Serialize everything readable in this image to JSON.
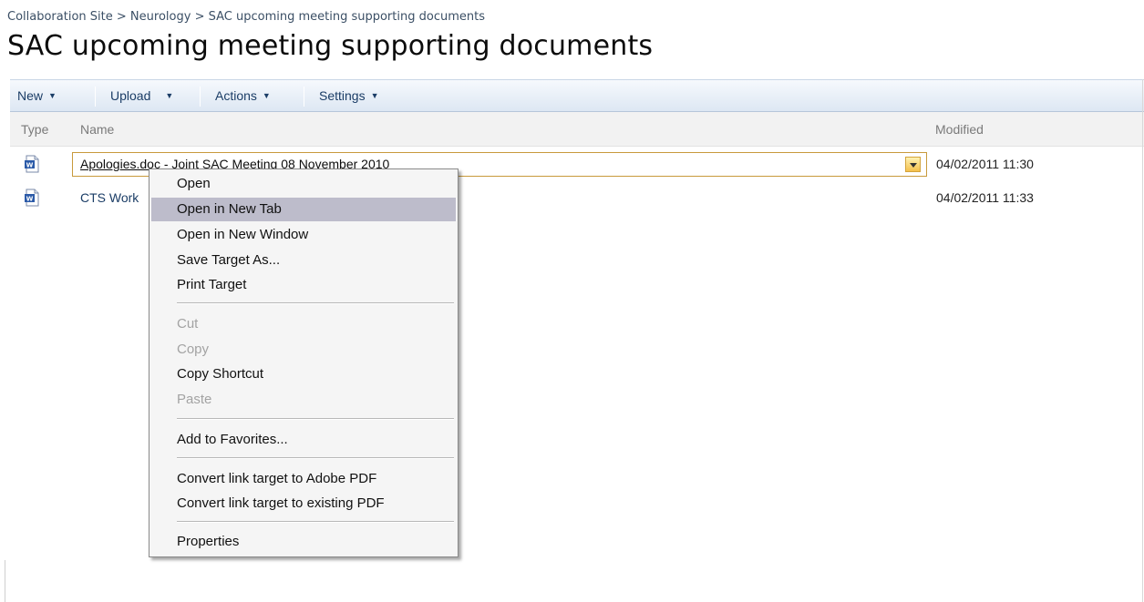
{
  "breadcrumb": {
    "items": [
      "Collaboration Site",
      "Neurology",
      "SAC upcoming meeting supporting documents"
    ],
    "separator": ">"
  },
  "page": {
    "title": "SAC upcoming meeting supporting documents"
  },
  "toolbar": {
    "new_label": "New",
    "upload_label": "Upload",
    "actions_label": "Actions",
    "settings_label": "Settings"
  },
  "list": {
    "headers": {
      "type": "Type",
      "name": "Name",
      "modified": "Modified"
    },
    "rows": [
      {
        "type_icon": "word-doc-icon",
        "name": "Apologies.doc - Joint SAC Meeting 08 November 2010",
        "modified": "04/02/2011 11:30"
      },
      {
        "type_icon": "word-doc-icon",
        "name": "CTS Work",
        "modified": "04/02/2011 11:33"
      }
    ]
  },
  "context_menu": {
    "items": [
      "Open",
      "Open in New Tab",
      "Open in New Window",
      "Save Target As...",
      "Print Target",
      "Cut",
      "Copy",
      "Copy Shortcut",
      "Paste",
      "Add to Favorites...",
      "Convert link target to Adobe PDF",
      "Convert link target to existing PDF",
      "Properties"
    ],
    "highlighted": "Open in New Tab",
    "disabled": [
      "Cut",
      "Copy",
      "Paste"
    ]
  },
  "colors": {
    "toolbar_text": "#1b3d66",
    "menu_highlight": "#bdbccb",
    "selection_border": "#c89a3c"
  }
}
